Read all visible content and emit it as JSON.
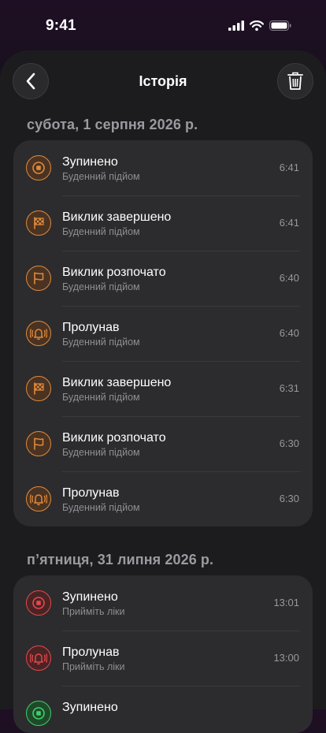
{
  "status_bar": {
    "time": "9:41"
  },
  "nav": {
    "title": "Історія"
  },
  "sections": [
    {
      "date": "субота, 1 серпня 2026 р.",
      "items": [
        {
          "title": "Зупинено",
          "subtitle": "Буденний підйом",
          "time": "6:41",
          "icon": "stop-icon",
          "color": "#e08a3c"
        },
        {
          "title": "Виклик завершено",
          "subtitle": "Буденний підйом",
          "time": "6:41",
          "icon": "checkered-flag-icon",
          "color": "#e08a3c"
        },
        {
          "title": "Виклик розпочато",
          "subtitle": "Буденний підйом",
          "time": "6:40",
          "icon": "flag-icon",
          "color": "#e08a3c"
        },
        {
          "title": "Пролунав",
          "subtitle": "Буденний підйом",
          "time": "6:40",
          "icon": "ringing-bell-icon",
          "color": "#e08a3c"
        },
        {
          "title": "Виклик завершено",
          "subtitle": "Буденний підйом",
          "time": "6:31",
          "icon": "checkered-flag-icon",
          "color": "#e08a3c"
        },
        {
          "title": "Виклик розпочато",
          "subtitle": "Буденний підйом",
          "time": "6:30",
          "icon": "flag-icon",
          "color": "#e08a3c"
        },
        {
          "title": "Пролунав",
          "subtitle": "Буденний підйом",
          "time": "6:30",
          "icon": "ringing-bell-icon",
          "color": "#e08a3c"
        }
      ]
    },
    {
      "date": "п’ятниця, 31 липня 2026 р.",
      "items": [
        {
          "title": "Зупинено",
          "subtitle": "Прийміть ліки",
          "time": "13:01",
          "icon": "stop-icon",
          "color": "#e5484d"
        },
        {
          "title": "Пролунав",
          "subtitle": "Прийміть ліки",
          "time": "13:00",
          "icon": "ringing-bell-icon",
          "color": "#e5484d"
        },
        {
          "title": "Зупинено",
          "subtitle": "",
          "time": "",
          "icon": "stop-icon",
          "color": "#3ecf6a"
        }
      ]
    }
  ]
}
